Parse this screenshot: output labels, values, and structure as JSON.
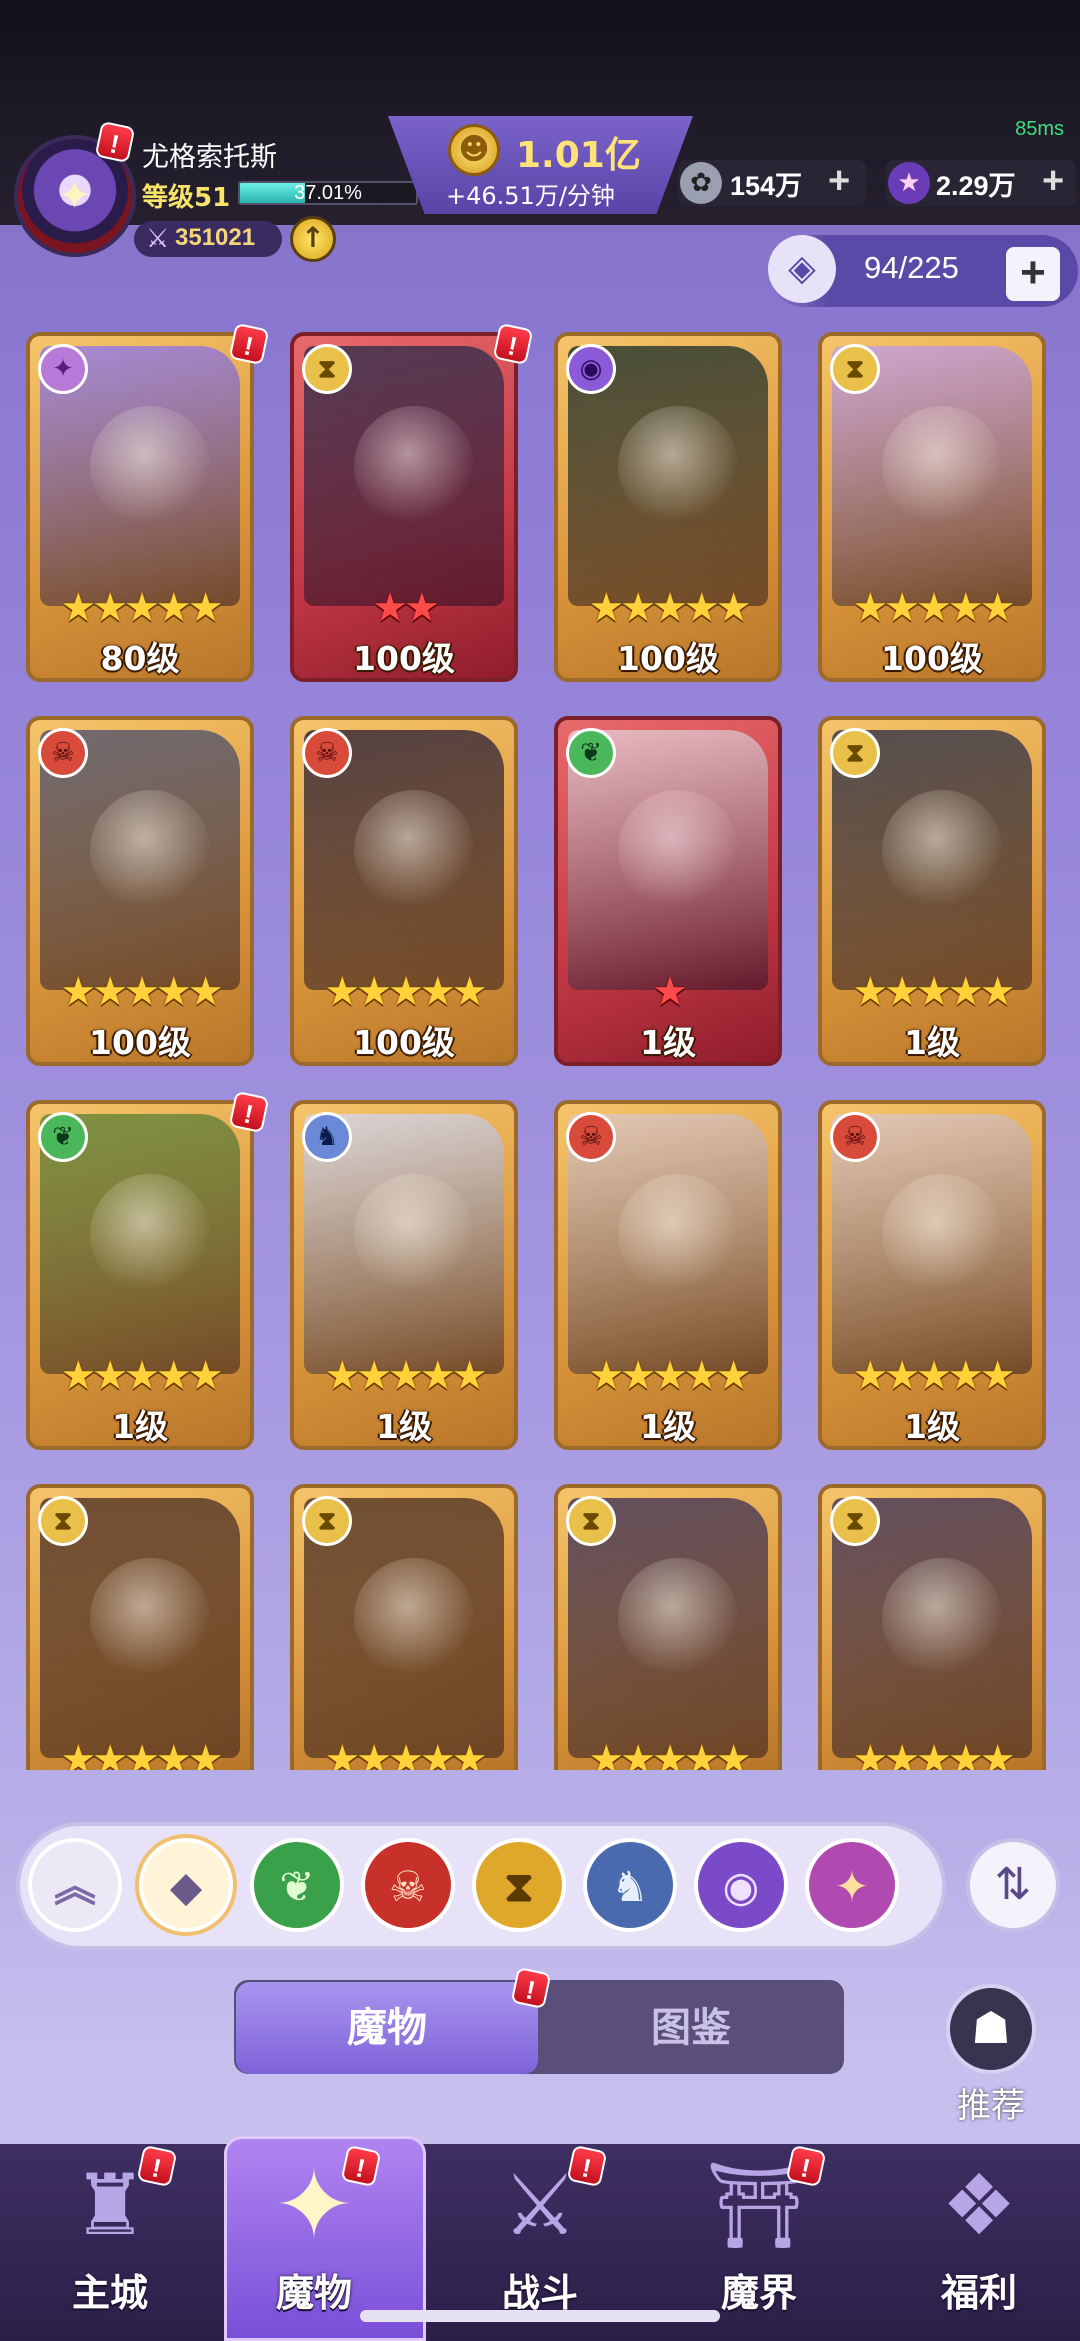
{
  "status": {
    "ping": "85ms"
  },
  "player": {
    "name": "尤格索托斯",
    "level_label": "等级51",
    "xp_percent": "37.01%",
    "xp_fraction": 0.3701,
    "power": "351021"
  },
  "currency": {
    "gold": "1.01亿",
    "gold_rate": "+46.51万/分钟",
    "silver": "154万",
    "crystal": "2.29万"
  },
  "roster": {
    "capacity": "94/225"
  },
  "cards": [
    {
      "level": "80级",
      "stars": 5,
      "star_color": "gold",
      "faction": "spiral",
      "frame": "gold",
      "alert": true
    },
    {
      "level": "100级",
      "stars": 2,
      "star_color": "red",
      "faction": "hourglass",
      "frame": "red",
      "alert": true
    },
    {
      "level": "100级",
      "stars": 5,
      "star_color": "gold",
      "faction": "eye",
      "frame": "gold",
      "alert": false
    },
    {
      "level": "100级",
      "stars": 5,
      "star_color": "gold",
      "faction": "hourglass",
      "frame": "gold",
      "alert": false
    },
    {
      "level": "100级",
      "stars": 5,
      "star_color": "gold",
      "faction": "skull",
      "frame": "gold",
      "alert": false
    },
    {
      "level": "100级",
      "stars": 5,
      "star_color": "gold",
      "faction": "skull",
      "frame": "gold",
      "alert": false
    },
    {
      "level": "1级",
      "stars": 1,
      "star_color": "red",
      "faction": "leaf",
      "frame": "red",
      "alert": false
    },
    {
      "level": "1级",
      "stars": 5,
      "star_color": "gold",
      "faction": "hourglass",
      "frame": "gold",
      "alert": false
    },
    {
      "level": "1级",
      "stars": 5,
      "star_color": "gold",
      "faction": "leaf",
      "frame": "gold",
      "alert": true
    },
    {
      "level": "1级",
      "stars": 5,
      "star_color": "gold",
      "faction": "dragon",
      "frame": "gold",
      "alert": false
    },
    {
      "level": "1级",
      "stars": 5,
      "star_color": "gold",
      "faction": "skull",
      "frame": "gold",
      "alert": false
    },
    {
      "level": "1级",
      "stars": 5,
      "star_color": "gold",
      "faction": "skull",
      "frame": "gold",
      "alert": false
    },
    {
      "level": "",
      "stars": 5,
      "star_color": "gold",
      "faction": "hourglass",
      "frame": "gold",
      "alert": false
    },
    {
      "level": "",
      "stars": 5,
      "star_color": "gold",
      "faction": "hourglass",
      "frame": "gold",
      "alert": false
    },
    {
      "level": "",
      "stars": 5,
      "star_color": "gold",
      "faction": "hourglass",
      "frame": "gold",
      "alert": false
    },
    {
      "level": "",
      "stars": 5,
      "star_color": "gold",
      "faction": "hourglass",
      "frame": "gold",
      "alert": false
    }
  ],
  "filters": [
    {
      "icon": "collapse-icon",
      "glyph": "︽"
    },
    {
      "icon": "all-factions-icon",
      "glyph": "◆"
    },
    {
      "icon": "leaf-faction-icon",
      "glyph": "❦"
    },
    {
      "icon": "skull-faction-icon",
      "glyph": "☠"
    },
    {
      "icon": "hourglass-faction-icon",
      "glyph": "⧗"
    },
    {
      "icon": "dragon-faction-icon",
      "glyph": "♞"
    },
    {
      "icon": "eye-faction-icon",
      "glyph": "◉"
    },
    {
      "icon": "spiral-faction-icon",
      "glyph": "✦"
    }
  ],
  "tabs": {
    "monsters": "魔物",
    "codex": "图鉴"
  },
  "recommend": "推荐",
  "nav": [
    {
      "label": "主城",
      "icon": "castle-icon",
      "glyph": "♜"
    },
    {
      "label": "魔物",
      "icon": "monster-flame-icon",
      "glyph": "✦"
    },
    {
      "label": "战斗",
      "icon": "sword-shield-icon",
      "glyph": "⚔"
    },
    {
      "label": "魔界",
      "icon": "portal-icon",
      "glyph": "⛩"
    },
    {
      "label": "福利",
      "icon": "treasure-chest-icon",
      "glyph": "❖"
    }
  ],
  "colors": {
    "gold_frame": "#d9943a",
    "red_frame": "#c23845",
    "accent_purple": "#7e63d8",
    "alert_red": "#e0202e"
  }
}
